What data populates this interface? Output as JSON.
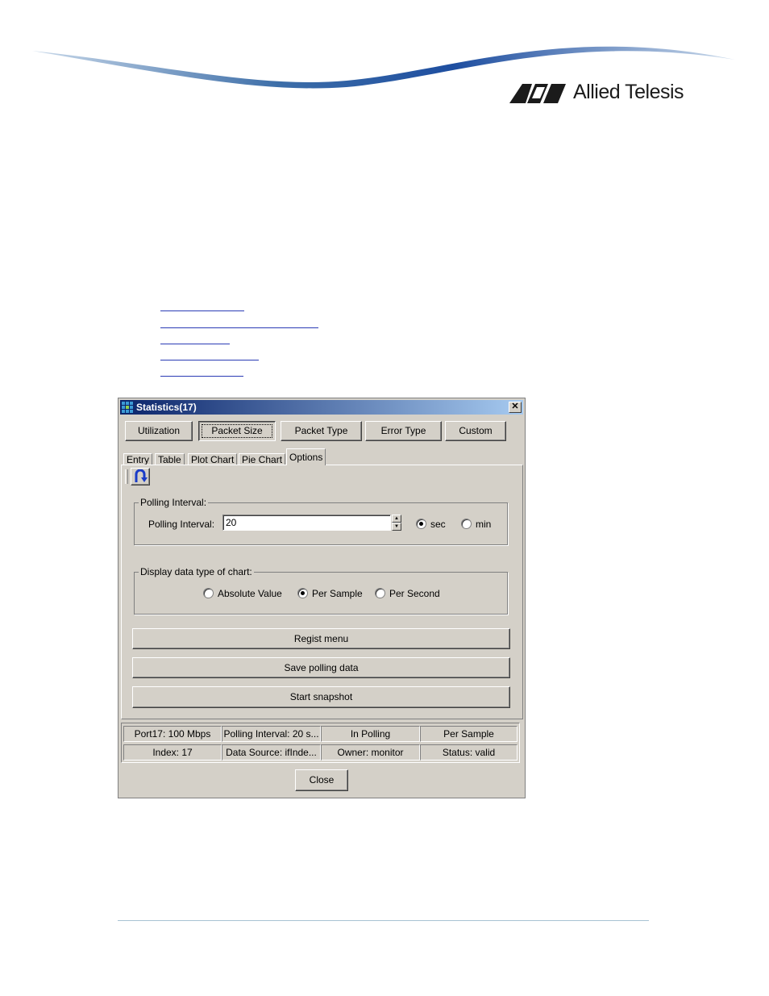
{
  "brand": {
    "logo_text": "Allied Telesis",
    "accent": "#1e4ea0"
  },
  "window": {
    "title": "Statistics(17)",
    "close_glyph": "✕"
  },
  "category_buttons": [
    {
      "label": "Utilization"
    },
    {
      "label": "Packet Size",
      "selected": true
    },
    {
      "label": "Packet Type"
    },
    {
      "label": "Error Type"
    },
    {
      "label": "Custom"
    }
  ],
  "tabs": [
    {
      "label": "Entry"
    },
    {
      "label": "Table"
    },
    {
      "label": "Plot Chart"
    },
    {
      "label": "Pie Chart"
    },
    {
      "label": "Options",
      "active": true
    }
  ],
  "options": {
    "polling_group_title": "Polling Interval:",
    "polling_label": "Polling Interval:",
    "polling_value": "20",
    "unit_sec": "sec",
    "unit_min": "min",
    "unit_selected": "sec",
    "display_group_title": "Display data type of chart:",
    "display_options": [
      "Absolute Value",
      "Per Sample",
      "Per Second"
    ],
    "display_selected": "Per Sample",
    "regist_button": "Regist menu",
    "save_button": "Save polling data",
    "snapshot_button": "Start snapshot"
  },
  "status": {
    "row1": [
      "Port17: 100 Mbps",
      "Polling Interval: 20 s...",
      "In Polling",
      "Per Sample"
    ],
    "row2": [
      "Index: 17",
      "Data Source: ifInde...",
      "Owner: monitor",
      "Status: valid"
    ]
  },
  "close_button": "Close"
}
